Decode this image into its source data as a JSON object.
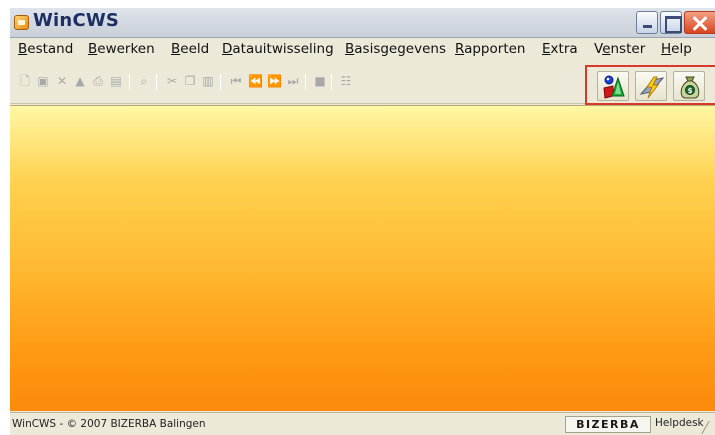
{
  "window": {
    "title": "WinCWS",
    "icon": "app-icon",
    "controls": [
      "minimize-icon",
      "maximize-icon",
      "close-icon"
    ]
  },
  "menu": [
    {
      "pre": "",
      "key": "B",
      "post": "estand"
    },
    {
      "pre": "",
      "key": "B",
      "post": "ewerken"
    },
    {
      "pre": "",
      "key": "B",
      "post": "eeld"
    },
    {
      "pre": "",
      "key": "D",
      "post": "atauitwisseling"
    },
    {
      "pre": "",
      "key": "B",
      "post": "asisgegevens"
    },
    {
      "pre": "",
      "key": "R",
      "post": "apporten"
    },
    {
      "pre": "",
      "key": "E",
      "post": "xtra"
    },
    {
      "pre": "V",
      "key": "e",
      "post": "nster"
    },
    {
      "pre": "",
      "key": "H",
      "post": "elp"
    }
  ],
  "toolbar": {
    "standard_icons": [
      "new-icon",
      "save-icon",
      "delete-icon",
      "stamp-icon",
      "print-icon",
      "print-preview-icon",
      "find-icon",
      "cut-icon",
      "copy-icon",
      "paste-icon",
      "first-record-icon",
      "previous-record-icon",
      "next-record-icon",
      "last-record-icon",
      "stop-icon",
      "report-icon"
    ],
    "special_icons": [
      "assortment-icon",
      "transfer-icon",
      "money-bag-icon"
    ],
    "special_highlight_color": "#d63a2a"
  },
  "colors": {
    "client_top": "#fff7a4",
    "client_bottom": "#fb8a0a",
    "title_text": "#1d2f63"
  },
  "status": {
    "text": "WinCWS - © 2007 BIZERBA Balingen",
    "logo": "BIZERBA",
    "help": "Helpdesk"
  }
}
